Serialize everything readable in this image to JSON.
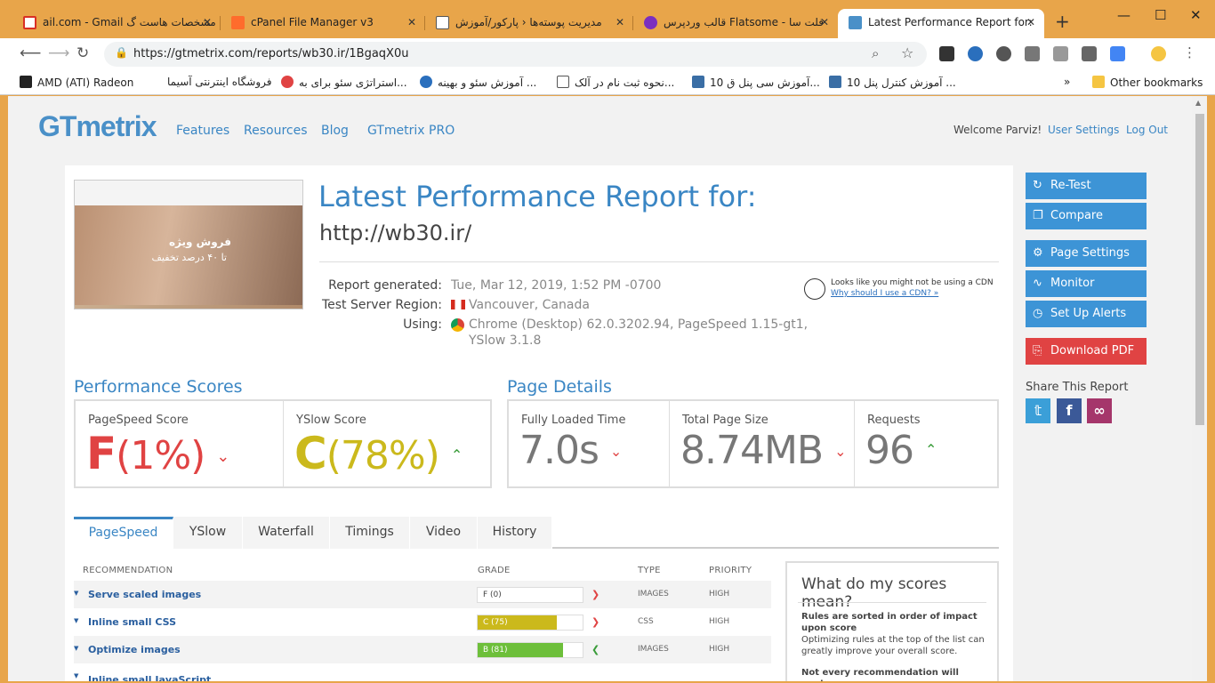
{
  "browser": {
    "tabs": [
      {
        "label": "ail.com - Gmail مشخصات هاست گ",
        "color": "#d93025"
      },
      {
        "label": "cPanel File Manager v3",
        "color": "#ff6c2c"
      },
      {
        "label": "مدیریت پوسته‌ها ‹ پارکور/آموزش",
        "color": "#666666"
      },
      {
        "label": "قالب وردپرس Flatsome - فلت سا",
        "color": "#7b2fbf"
      },
      {
        "label": "Latest Performance Report for:",
        "color": "#4a90c8"
      }
    ],
    "new_tab": "+",
    "window_controls": [
      "—",
      "☐",
      "✕"
    ],
    "url": "https://gtmetrix.com/reports/wb30.ir/1BgaqX0u",
    "bookmarks": [
      "AMD (ATI) Radeon",
      "فروشگاه اینترنتی آسیما",
      "استراتژی سئو برای به...",
      "آموزش سئو و بهینه ...",
      "نحوه ثبت نام در آلک...",
      "10 آموزش سی پنل ق...",
      "10 آموزش کنترل پنل ...",
      "»",
      "Other bookmarks"
    ]
  },
  "header": {
    "logo": "GTmetrix",
    "nav": [
      "Features",
      "Resources",
      "Blog",
      "GTmetrix PRO"
    ],
    "welcome": "Welcome Parviz!",
    "user_settings": "User Settings",
    "logout": "Log Out"
  },
  "report": {
    "title": "Latest Performance Report for:",
    "url": "http://wb30.ir/",
    "thumb_text1": "فروش ویژه",
    "thumb_text2": "تا ۴۰ درصد تخفیف",
    "meta": [
      {
        "label": "Report generated:",
        "value": "Tue, Mar 12, 2019, 1:52 PM -0700"
      },
      {
        "label": "Test Server Region:",
        "value": "Vancouver, Canada"
      },
      {
        "label": "Using:",
        "value": "Chrome (Desktop) 62.0.3202.94, PageSpeed 1.15-gt1,"
      },
      {
        "label": "",
        "value": "YSlow 3.1.8"
      }
    ],
    "cdn_notice": "Looks like you might not be using a CDN",
    "cdn_link": "Why should I use a CDN? »"
  },
  "performance": {
    "heading": "Performance Scores",
    "pagespeed_label": "PageSpeed Score",
    "pagespeed_grade": "F",
    "pagespeed_pct": "(1%)",
    "yslow_label": "YSlow Score",
    "yslow_grade": "C",
    "yslow_pct": "(78%)"
  },
  "details": {
    "heading": "Page Details",
    "load_label": "Fully Loaded Time",
    "load_value": "7.0s",
    "size_label": "Total Page Size",
    "size_value": "8.74MB",
    "req_label": "Requests",
    "req_value": "96"
  },
  "tabs": [
    "PageSpeed",
    "YSlow",
    "Waterfall",
    "Timings",
    "Video",
    "History"
  ],
  "table": {
    "headers": {
      "rec": "RECOMMENDATION",
      "grade": "GRADE",
      "type": "TYPE",
      "priority": "PRIORITY"
    },
    "rows": [
      {
        "name": "Serve scaled images",
        "grade": "F (0)",
        "score": 0,
        "type": "IMAGES",
        "priority": "HIGH",
        "trend": "down"
      },
      {
        "name": "Inline small CSS",
        "grade": "C (75)",
        "score": 75,
        "type": "CSS",
        "priority": "HIGH",
        "trend": "down"
      },
      {
        "name": "Optimize images",
        "grade": "B (81)",
        "score": 81,
        "type": "IMAGES",
        "priority": "HIGH",
        "trend": "up"
      }
    ],
    "partial_row_name": "Inline small JavaScript"
  },
  "scores_help": {
    "title": "What do my scores mean?",
    "p1_bold": "Rules are sorted in order of impact upon score",
    "p1": "Optimizing rules at the top of the list can greatly improve your overall score.",
    "p2_bold": "Not every recommendation will apply"
  },
  "sidebar": {
    "retest": "Re-Test",
    "compare": "Compare",
    "page_settings": "Page Settings",
    "monitor": "Monitor",
    "alerts": "Set Up Alerts",
    "download": "Download PDF",
    "share": "Share This Report"
  },
  "colors": {
    "accent": "#3a86c4",
    "fail": "#e04343",
    "warn": "#cbb91c",
    "good": "#6dbf3a"
  }
}
